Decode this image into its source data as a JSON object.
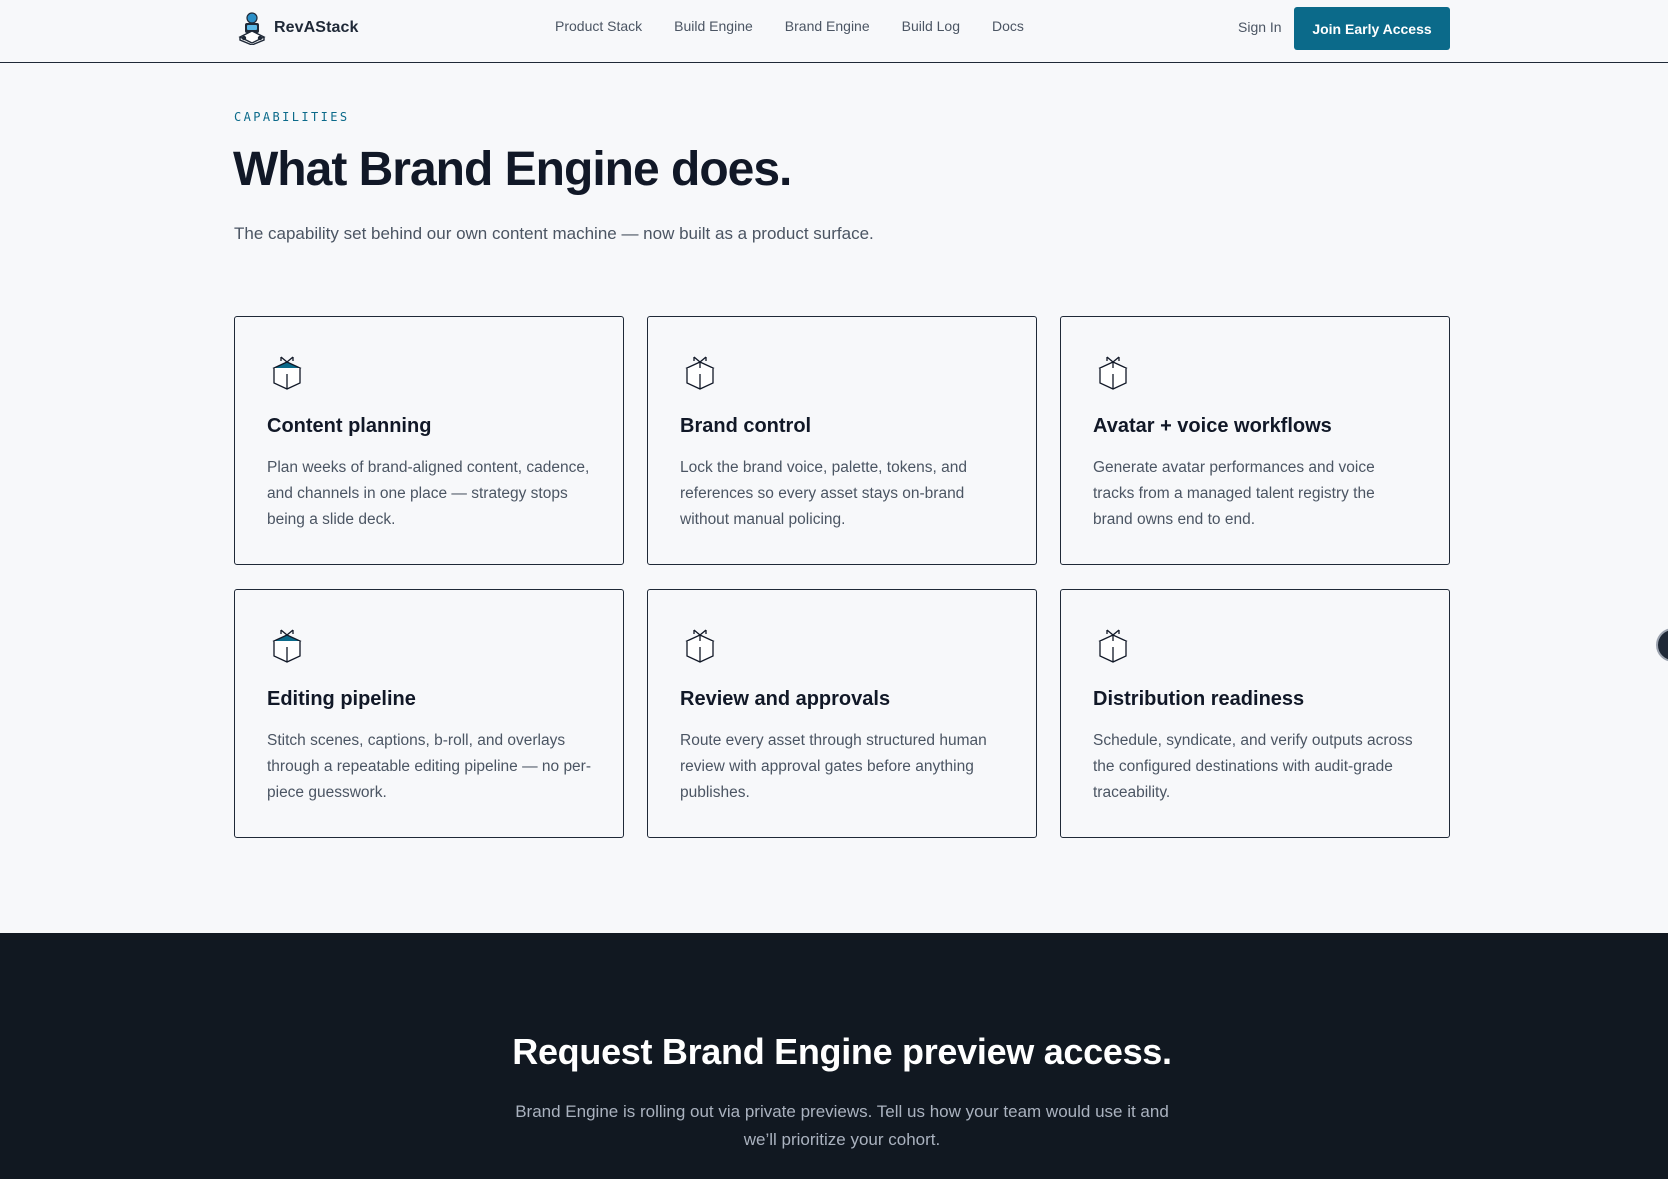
{
  "nav": {
    "brand": "RevAStack",
    "links": [
      "Product Stack",
      "Build Engine",
      "Brand Engine",
      "Build Log",
      "Docs"
    ],
    "sign_in": "Sign In",
    "cta": "Join Early Access"
  },
  "hero": {
    "eyebrow": "CAPABILITIES",
    "title": "What Brand Engine does.",
    "subtitle": "The capability set behind our own content machine — now built as a product surface."
  },
  "cards": [
    {
      "title": "Content planning",
      "desc": "Plan weeks of brand-aligned content, cadence, and channels in one place — strategy stops being a slide deck.",
      "icon": "filled-box-icon"
    },
    {
      "title": "Brand control",
      "desc": "Lock the brand voice, palette, tokens, and references so every asset stays on-brand without manual policing.",
      "icon": "box-icon"
    },
    {
      "title": "Avatar + voice workflows",
      "desc": "Generate avatar performances and voice tracks from a managed talent registry the brand owns end to end.",
      "icon": "box-icon"
    },
    {
      "title": "Editing pipeline",
      "desc": "Stitch scenes, captions, b-roll, and overlays through a repeatable editing pipeline — no per-piece guesswork.",
      "icon": "filled-box-icon"
    },
    {
      "title": "Review and approvals",
      "desc": "Route every asset through structured human review with approval gates before anything publishes.",
      "icon": "box-icon"
    },
    {
      "title": "Distribution readiness",
      "desc": "Schedule, syndicate, and verify outputs across the configured destinations with audit-grade traceability.",
      "icon": "box-icon"
    }
  ],
  "cta_section": {
    "title": "Request Brand Engine preview access.",
    "subtitle": "Brand Engine is rolling out via private previews. Tell us how your team would use it and we’ll prioritize your cohort."
  },
  "colors": {
    "accent": "#0b6a8a",
    "dark_bg": "#111821",
    "page_bg": "#f7f8fa"
  }
}
